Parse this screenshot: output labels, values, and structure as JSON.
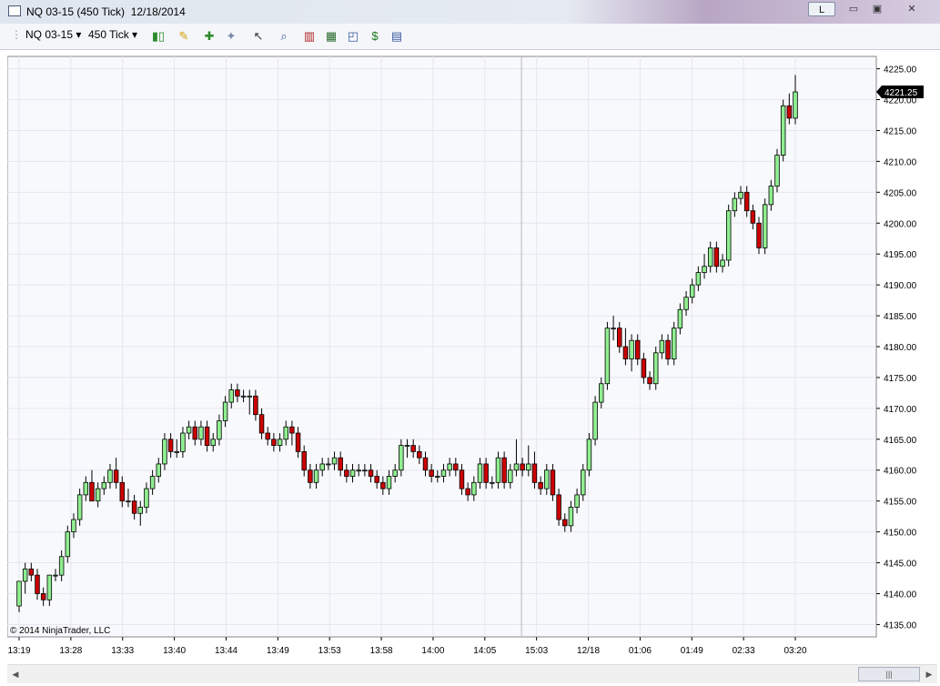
{
  "window": {
    "title": "NQ 03-15 (450 Tick)  12/18/2014",
    "buttons": {
      "l_label": "L",
      "minimize": "▭",
      "maximize": "▣",
      "close": "✕"
    },
    "icon": "chart-window-icon"
  },
  "toolbar": {
    "instrument": "NQ 03-15",
    "interval": "450 Tick",
    "icons": [
      "candlestick-style-icon",
      "pencil-draw-icon",
      "add-indicator-icon",
      "strategy-icon",
      "pointer-icon",
      "zoom-icon",
      "bar-chart-icon",
      "data-box-icon",
      "chart-properties-icon",
      "dollar-icon",
      "panel-icon"
    ]
  },
  "chart": {
    "copyright": "© 2014 NinjaTrader, LLC",
    "last_price_label": "4221.25",
    "colors": {
      "up": "#90ee90",
      "down": "#cc0000",
      "wick": "#000000",
      "grid": "#e6e6ee",
      "bg": "#f8f9fd",
      "separator": "#b8b8b8"
    }
  },
  "chart_data": {
    "type": "candlestick",
    "ylim": [
      4133,
      4227
    ],
    "y_ticks": [
      "4135.00",
      "4140.00",
      "4145.00",
      "4150.00",
      "4155.00",
      "4160.00",
      "4165.00",
      "4170.00",
      "4175.00",
      "4180.00",
      "4185.00",
      "4190.00",
      "4195.00",
      "4200.00",
      "4205.00",
      "4210.00",
      "4215.00",
      "4220.00",
      "4225.00"
    ],
    "x_ticks": [
      "13:19",
      "13:28",
      "13:33",
      "13:40",
      "13:44",
      "13:49",
      "13:53",
      "13:58",
      "14:00",
      "14:05",
      "15:03",
      "12/18",
      "01:06",
      "01:49",
      "02:33",
      "03:20"
    ],
    "last_price": 4221.25,
    "candles": [
      [
        4138,
        4142,
        4137,
        4142
      ],
      [
        4142,
        4145,
        4140,
        4144
      ],
      [
        4144,
        4145,
        4142,
        4143
      ],
      [
        4143,
        4144,
        4139,
        4140
      ],
      [
        4140,
        4141,
        4138,
        4139
      ],
      [
        4139,
        4143,
        4138,
        4143
      ],
      [
        4143,
        4144,
        4142,
        4143
      ],
      [
        4143,
        4147,
        4142,
        4146
      ],
      [
        4146,
        4151,
        4145,
        4150
      ],
      [
        4150,
        4153,
        4149,
        4152
      ],
      [
        4152,
        4157,
        4151,
        4156
      ],
      [
        4156,
        4159,
        4155,
        4158
      ],
      [
        4158,
        4160,
        4155,
        4155
      ],
      [
        4155,
        4158,
        4154,
        4157
      ],
      [
        4157,
        4159,
        4156,
        4158
      ],
      [
        4158,
        4161,
        4157,
        4160
      ],
      [
        4160,
        4162,
        4157,
        4158
      ],
      [
        4158,
        4159,
        4154,
        4155
      ],
      [
        4155,
        4157,
        4154,
        4155
      ],
      [
        4155,
        4156,
        4152,
        4153
      ],
      [
        4153,
        4155,
        4151,
        4154
      ],
      [
        4154,
        4158,
        4153,
        4157
      ],
      [
        4157,
        4160,
        4156,
        4159
      ],
      [
        4159,
        4162,
        4158,
        4161
      ],
      [
        4161,
        4166,
        4160,
        4165
      ],
      [
        4165,
        4166,
        4162,
        4163
      ],
      [
        4163,
        4165,
        4162,
        4163
      ],
      [
        4163,
        4167,
        4162,
        4166
      ],
      [
        4166,
        4168,
        4165,
        4167
      ],
      [
        4167,
        4168,
        4164,
        4165
      ],
      [
        4165,
        4168,
        4164,
        4167
      ],
      [
        4167,
        4168,
        4163,
        4164
      ],
      [
        4164,
        4166,
        4163,
        4165
      ],
      [
        4165,
        4169,
        4164,
        4168
      ],
      [
        4168,
        4172,
        4167,
        4171
      ],
      [
        4171,
        4174,
        4170,
        4173
      ],
      [
        4173,
        4174,
        4171,
        4172
      ],
      [
        4172,
        4173,
        4171,
        4172
      ],
      [
        4172,
        4173,
        4169,
        4172
      ],
      [
        4172,
        4173,
        4168,
        4169
      ],
      [
        4169,
        4170,
        4165,
        4166
      ],
      [
        4166,
        4167,
        4164,
        4165
      ],
      [
        4165,
        4166,
        4163,
        4164
      ],
      [
        4164,
        4166,
        4163,
        4165
      ],
      [
        4165,
        4168,
        4164,
        4167
      ],
      [
        4167,
        4168,
        4164,
        4166
      ],
      [
        4166,
        4167,
        4162,
        4163
      ],
      [
        4163,
        4164,
        4159,
        4160
      ],
      [
        4160,
        4161,
        4157,
        4158
      ],
      [
        4158,
        4161,
        4157,
        4160
      ],
      [
        4160,
        4162,
        4159,
        4161
      ],
      [
        4161,
        4162,
        4160,
        4161
      ],
      [
        4161,
        4163,
        4160,
        4162
      ],
      [
        4162,
        4163,
        4159,
        4160
      ],
      [
        4160,
        4161,
        4158,
        4159
      ],
      [
        4159,
        4161,
        4158,
        4160
      ],
      [
        4160,
        4161,
        4159,
        4160
      ],
      [
        4160,
        4161,
        4159,
        4160
      ],
      [
        4160,
        4161,
        4158,
        4159
      ],
      [
        4159,
        4160,
        4157,
        4158
      ],
      [
        4158,
        4159,
        4156,
        4157
      ],
      [
        4157,
        4160,
        4156,
        4159
      ],
      [
        4159,
        4161,
        4158,
        4160
      ],
      [
        4160,
        4165,
        4159,
        4164
      ],
      [
        4164,
        4165,
        4162,
        4164
      ],
      [
        4164,
        4165,
        4162,
        4163
      ],
      [
        4163,
        4164,
        4161,
        4162
      ],
      [
        4162,
        4163,
        4159,
        4160
      ],
      [
        4160,
        4161,
        4158,
        4159
      ],
      [
        4159,
        4160,
        4158,
        4159
      ],
      [
        4159,
        4161,
        4158,
        4160
      ],
      [
        4160,
        4162,
        4159,
        4161
      ],
      [
        4161,
        4162,
        4159,
        4160
      ],
      [
        4160,
        4161,
        4156,
        4157
      ],
      [
        4157,
        4158,
        4155,
        4156
      ],
      [
        4156,
        4159,
        4155,
        4158
      ],
      [
        4158,
        4162,
        4157,
        4161
      ],
      [
        4161,
        4162,
        4157,
        4158
      ],
      [
        4158,
        4159,
        4157,
        4158
      ],
      [
        4158,
        4163,
        4157,
        4162
      ],
      [
        4162,
        4163,
        4157,
        4158
      ],
      [
        4158,
        4161,
        4157,
        4160
      ],
      [
        4160,
        4165,
        4159,
        4161
      ],
      [
        4161,
        4162,
        4159,
        4160
      ],
      [
        4160,
        4164,
        4159,
        4161
      ],
      [
        4161,
        4163,
        4157,
        4158
      ],
      [
        4158,
        4159,
        4156,
        4157
      ],
      [
        4157,
        4161,
        4156,
        4160
      ],
      [
        4160,
        4161,
        4155,
        4156
      ],
      [
        4156,
        4157,
        4151,
        4152
      ],
      [
        4152,
        4153,
        4150,
        4151
      ],
      [
        4151,
        4155,
        4150,
        4154
      ],
      [
        4154,
        4157,
        4153,
        4156
      ],
      [
        4156,
        4161,
        4155,
        4160
      ],
      [
        4160,
        4166,
        4159,
        4165
      ],
      [
        4165,
        4172,
        4164,
        4171
      ],
      [
        4171,
        4175,
        4170,
        4174
      ],
      [
        4174,
        4184,
        4173,
        4183
      ],
      [
        4183,
        4185,
        4181,
        4183
      ],
      [
        4183,
        4184,
        4179,
        4180
      ],
      [
        4180,
        4183,
        4177,
        4178
      ],
      [
        4178,
        4182,
        4176,
        4181
      ],
      [
        4181,
        4182,
        4177,
        4178
      ],
      [
        4178,
        4179,
        4174,
        4175
      ],
      [
        4175,
        4176,
        4173,
        4174
      ],
      [
        4174,
        4180,
        4173,
        4179
      ],
      [
        4179,
        4182,
        4178,
        4181
      ],
      [
        4181,
        4182,
        4177,
        4178
      ],
      [
        4178,
        4184,
        4177,
        4183
      ],
      [
        4183,
        4187,
        4182,
        4186
      ],
      [
        4186,
        4189,
        4185,
        4188
      ],
      [
        4188,
        4191,
        4187,
        4190
      ],
      [
        4190,
        4193,
        4189,
        4192
      ],
      [
        4192,
        4195,
        4191,
        4193
      ],
      [
        4193,
        4197,
        4192,
        4196
      ],
      [
        4196,
        4197,
        4192,
        4193
      ],
      [
        4193,
        4195,
        4192,
        4194
      ],
      [
        4194,
        4203,
        4193,
        4202
      ],
      [
        4202,
        4205,
        4201,
        4204
      ],
      [
        4204,
        4206,
        4203,
        4205
      ],
      [
        4205,
        4206,
        4201,
        4202
      ],
      [
        4202,
        4203,
        4199,
        4200
      ],
      [
        4200,
        4201,
        4195,
        4196
      ],
      [
        4196,
        4204,
        4195,
        4203
      ],
      [
        4203,
        4207,
        4202,
        4206
      ],
      [
        4206,
        4212,
        4205,
        4211
      ],
      [
        4211,
        4220,
        4210,
        4219
      ],
      [
        4219,
        4221,
        4216,
        4217
      ],
      [
        4217,
        4224,
        4216,
        4221.25
      ]
    ]
  }
}
